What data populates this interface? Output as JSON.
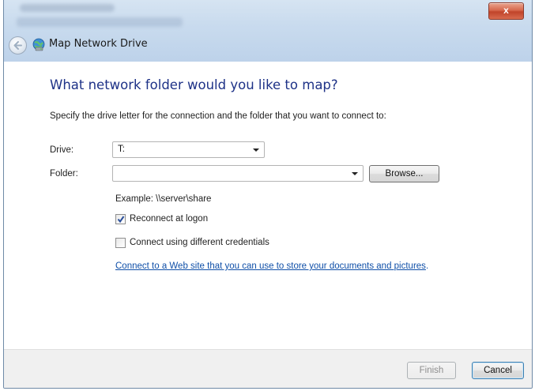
{
  "window": {
    "title": "Map Network Drive",
    "close_label": "x"
  },
  "page": {
    "heading": "What network folder would you like to map?",
    "instructions": "Specify the drive letter for the connection and the folder that you want to connect to:"
  },
  "form": {
    "drive_label": "Drive:",
    "drive_value": "T:",
    "folder_label": "Folder:",
    "folder_value": "",
    "browse_label": "Browse...",
    "example_text": "Example: \\\\server\\share",
    "reconnect_label": "Reconnect at logon",
    "reconnect_checked": true,
    "credentials_label": "Connect using different credentials",
    "credentials_checked": false,
    "web_link_text": "Connect to a Web site that you can use to store your documents and pictures",
    "web_link_suffix": "."
  },
  "footer": {
    "finish_label": "Finish",
    "cancel_label": "Cancel"
  },
  "colors": {
    "heading": "#1e3287",
    "link": "#0f4fa8",
    "close_button": "#c0442a"
  },
  "icons": [
    "back-arrow-icon",
    "network-drive-icon",
    "dropdown-arrow-icon",
    "checkmark-icon"
  ]
}
